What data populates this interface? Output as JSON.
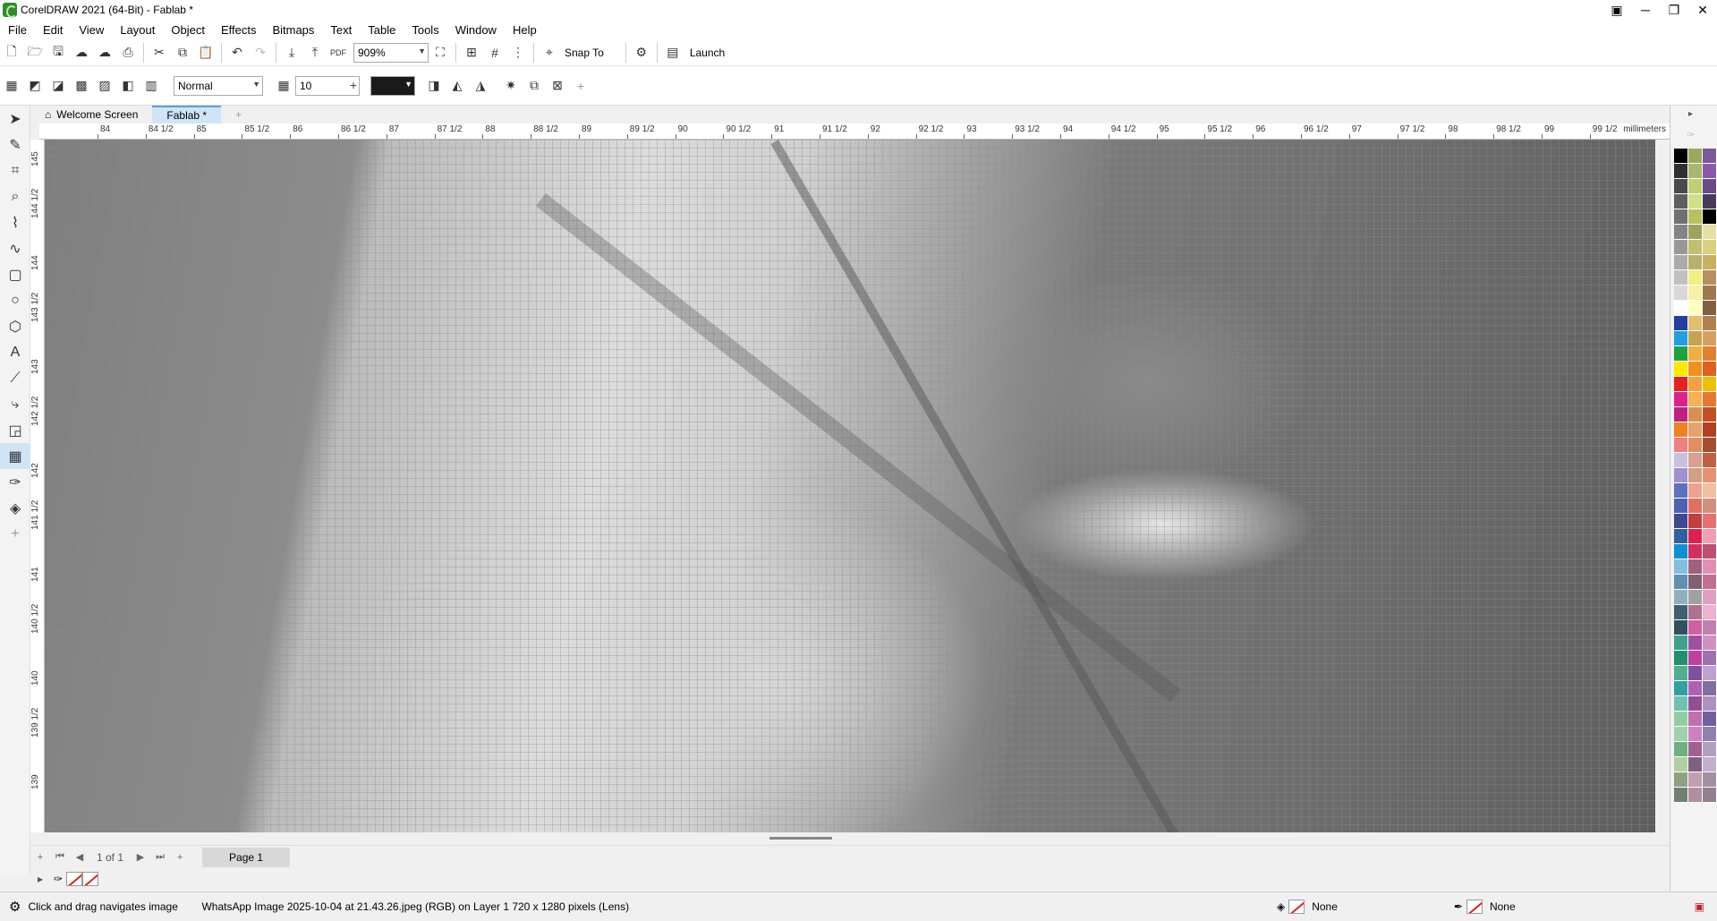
{
  "window": {
    "title": "CorelDRAW 2021 (64-Bit) - Fablab *"
  },
  "menu": [
    "File",
    "Edit",
    "View",
    "Layout",
    "Object",
    "Effects",
    "Bitmaps",
    "Text",
    "Table",
    "Tools",
    "Window",
    "Help"
  ],
  "toolbar": {
    "zoom": "909%",
    "snap_label": "Snap To",
    "launch_label": "Launch"
  },
  "propbar": {
    "mode": "Normal",
    "size": "10"
  },
  "tabs": [
    "Welcome Screen",
    "Fablab *"
  ],
  "ruler": {
    "unit": "millimeters",
    "h_labels": [
      "84",
      "84 1/2",
      "85",
      "85 1/2",
      "86",
      "86 1/2",
      "87",
      "87 1/2",
      "88",
      "88 1/2",
      "89",
      "89 1/2",
      "90",
      "90 1/2",
      "91",
      "91 1/2",
      "92",
      "92 1/2",
      "93",
      "93 1/2",
      "94",
      "94 1/2",
      "95",
      "95 1/2",
      "96",
      "96 1/2",
      "97",
      "97 1/2",
      "98",
      "98 1/2",
      "99",
      "99 1/2"
    ],
    "v_labels": [
      "145",
      "144 1/2",
      "144",
      "143 1/2",
      "143",
      "142 1/2",
      "142",
      "141 1/2",
      "141",
      "140 1/2",
      "140",
      "139 1/2",
      "139"
    ]
  },
  "pages": {
    "counter": "1 of 1",
    "tab": "Page 1"
  },
  "status": {
    "hint": "Click and drag navigates image",
    "info": "WhatsApp Image 2025-10-04 at 21.43.26.jpeg (RGB) on Layer 1 720 x 1280 pixels  (Lens)",
    "fill": "None",
    "outline": "None"
  },
  "palette": [
    "#000000",
    "#9aaa5a",
    "#7b5a9a",
    "#303030",
    "#a8b870",
    "#8a5aa8",
    "#4a4a4a",
    "#c0d070",
    "#6a4a8a",
    "#5e5e5e",
    "#d0e08a",
    "#4a3a5a",
    "#707070",
    "#b8c060",
    "#000000",
    "#848484",
    "#a0a060",
    "#e8e0a0",
    "#989898",
    "#c0c070",
    "#d8d080",
    "#ababab",
    "#b8b070",
    "#c8b060",
    "#c0c0c0",
    "#f0f080",
    "#b89060",
    "#d8d8d8",
    "#f8f0a0",
    "#a07850",
    "#ffffff",
    "#ffffc0",
    "#806040",
    "#2040a0",
    "#e0c070",
    "#b08050",
    "#1ea0e0",
    "#c8a050",
    "#d8a060",
    "#20a040",
    "#f0b040",
    "#e08030",
    "#ffe800",
    "#f09020",
    "#e06020",
    "#e82020",
    "#f8a040",
    "#f0c000",
    "#e0208a",
    "#f8b050",
    "#e87830",
    "#c02080",
    "#d89050",
    "#c85020",
    "#f08020",
    "#e8a070",
    "#b04020",
    "#f08080",
    "#e09060",
    "#a05030",
    "#c8c0e0",
    "#d8a090",
    "#c06040",
    "#a090d0",
    "#d0a080",
    "#e89070",
    "#6070c0",
    "#f0a090",
    "#f0c0a0",
    "#5060b0",
    "#e07060",
    "#d09080",
    "#404890",
    "#c04040",
    "#e87070",
    "#3060a0",
    "#e02050",
    "#f0a0b0",
    "#1090d0",
    "#d03060",
    "#c05070",
    "#80c0e0",
    "#a06080",
    "#e090b0",
    "#6090b0",
    "#806070",
    "#c07090",
    "#90b0c0",
    "#a0a0a0",
    "#e0a0c0",
    "#406070",
    "#b07090",
    "#f0b0d0",
    "#305060",
    "#d060a0",
    "#c080b0",
    "#40a090",
    "#a050a0",
    "#d090c0",
    "#209070",
    "#c040a0",
    "#a070b0",
    "#50b090",
    "#8050a0",
    "#c0a0d0",
    "#30a0a0",
    "#b060b0",
    "#8070a0",
    "#70c0b0",
    "#905090",
    "#b090c0",
    "#90d0a0",
    "#c070b0",
    "#7060a0",
    "#a0d0b0",
    "#d080c0",
    "#9080b0",
    "#70b080",
    "#a06090",
    "#b0a0c0",
    "#b0d0a0",
    "#806080",
    "#c0b0d0",
    "#90a080",
    "#c0a0b0",
    "#a090a0",
    "#708070",
    "#b090a0",
    "#908090"
  ]
}
